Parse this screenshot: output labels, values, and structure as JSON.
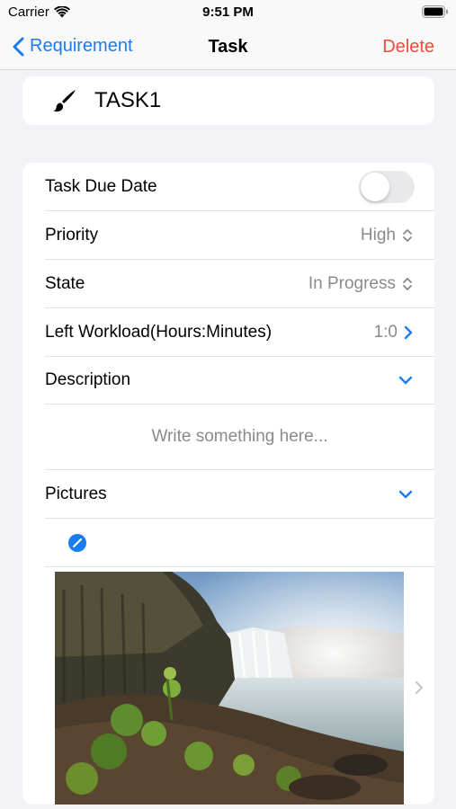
{
  "status": {
    "carrier": "Carrier",
    "time": "9:51 PM"
  },
  "nav": {
    "back_label": "Requirement",
    "title": "Task",
    "delete_label": "Delete"
  },
  "task": {
    "name": "TASK1",
    "icon": "paintbrush-icon"
  },
  "form": {
    "due_date": {
      "label": "Task Due Date",
      "enabled": false
    },
    "priority": {
      "label": "Priority",
      "value": "High"
    },
    "state": {
      "label": "State",
      "value": "In Progress"
    },
    "workload": {
      "label": "Left Workload(Hours:Minutes)",
      "value": "1:0"
    },
    "description": {
      "label": "Description",
      "placeholder": "Write something here..."
    },
    "pictures": {
      "label": "Pictures"
    }
  },
  "colors": {
    "accent": "#1a7cf2",
    "destructive": "#f24a3c",
    "secondary_text": "#8a8a8e",
    "background": "#f2f2f7"
  }
}
